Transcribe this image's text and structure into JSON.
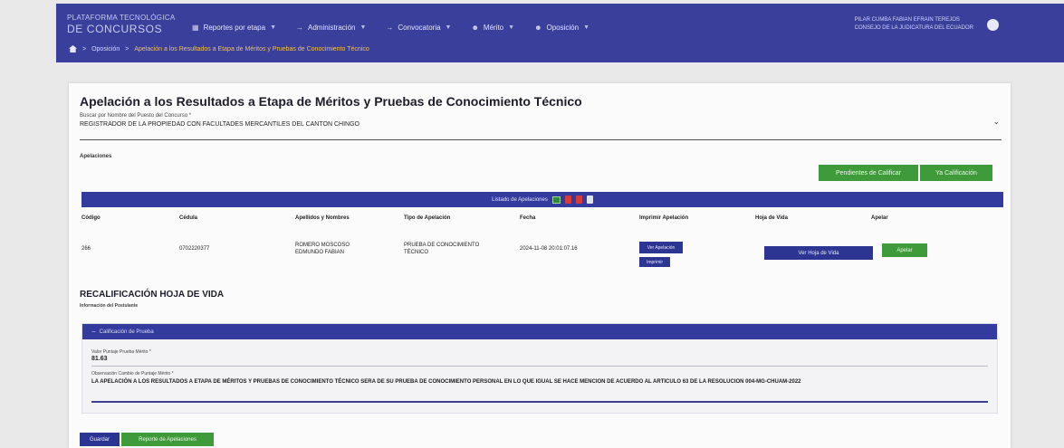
{
  "header": {
    "brand_line1": "PLATAFORMA TECNOLÓGICA",
    "brand_line2": "DE CONCURSOS",
    "nav": [
      {
        "label": "Reportes por etapa",
        "icon": "report-icon"
      },
      {
        "label": "Administración",
        "icon": "admin-icon"
      },
      {
        "label": "Convocatoria",
        "icon": "arrow-icon"
      },
      {
        "label": "Mérito",
        "icon": "person-icon"
      },
      {
        "label": "Oposición",
        "icon": "person-icon"
      }
    ],
    "user_line1": "PILAR CUMBA FABIAN EFRAIN TEREJOS",
    "user_line2": "CONSEJO DE LA JUDICATURA DEL ECUADOR"
  },
  "breadcrumb": {
    "item1": "Oposición",
    "current": "Apelación a los Resultados a Etapa de Méritos y Pruebas de Conocimiento Técnico"
  },
  "main": {
    "title": "Apelación a los Resultados a Etapa de Méritos y Pruebas de Conocimiento Técnico",
    "select_label": "Buscar por Nombre del Puesto del Concurso *",
    "select_value": "REGISTRADOR DE LA PROPIEDAD CON FACULTADES MERCANTILES DEL CANTON CHINGO",
    "section_label": "Apelaciones",
    "btn_pendientes": "Pendientes de Calificar",
    "btn_calificacion": "Ya Calificación",
    "list_title": "Listado de Apelaciones"
  },
  "table": {
    "columns": [
      "Código",
      "Cédula",
      "Apellidos y Nombres",
      "Tipo de Apelación",
      "Fecha",
      "Imprimir Apelación",
      "Hoja de Vida",
      "Apelar"
    ],
    "row": {
      "codigo": "266",
      "cedula": "0702220377",
      "nombres": "ROMERO MOSCOSO EDMUNDO FABIAN",
      "tipo": "PRUEBA DE CONOCIMIENTO TÉCNICO",
      "fecha": "2024-11-08 20:01:07.16",
      "btn_ver_apelacion": "Ver Apelación",
      "btn_imprimir": "Imprimir",
      "btn_hoja_vida": "Ver Hoja de Vida",
      "btn_apelar": "Apelar"
    }
  },
  "recal": {
    "title": "RECALIFICACIÓN HOJA DE VIDA",
    "subtitle": "Información del Postulante",
    "panel_title": "Calificación de Prueba",
    "field1_label": "Valor Puntaje Prueba Mérito *",
    "field1_value": "81.63",
    "field2_label": "Observación Cambio de Puntaje Mérito *",
    "field2_value": "LA APELACIÓN A LOS RESULTADOS A ETAPA DE MÉRITOS Y PRUEBAS DE CONOCIMIENTO TÉCNICO SERA DE SU PRUEBA DE CONOCIMIENTO PERSONAL EN LO QUE IGUAL SE HACE MENCION DE ACUERDO AL ARTICULO 63 DE LA RESOLUCION 004-MG-CHUAM-2022"
  },
  "footer": {
    "btn_guardar": "Guardar",
    "btn_reporte": "Reporte de Apelaciones"
  },
  "colors": {
    "header_bg": "#3a3f9c",
    "panel_header": "#343b9f",
    "accent_green": "#3f9b3a",
    "breadcrumb_active": "#f1c14c"
  }
}
